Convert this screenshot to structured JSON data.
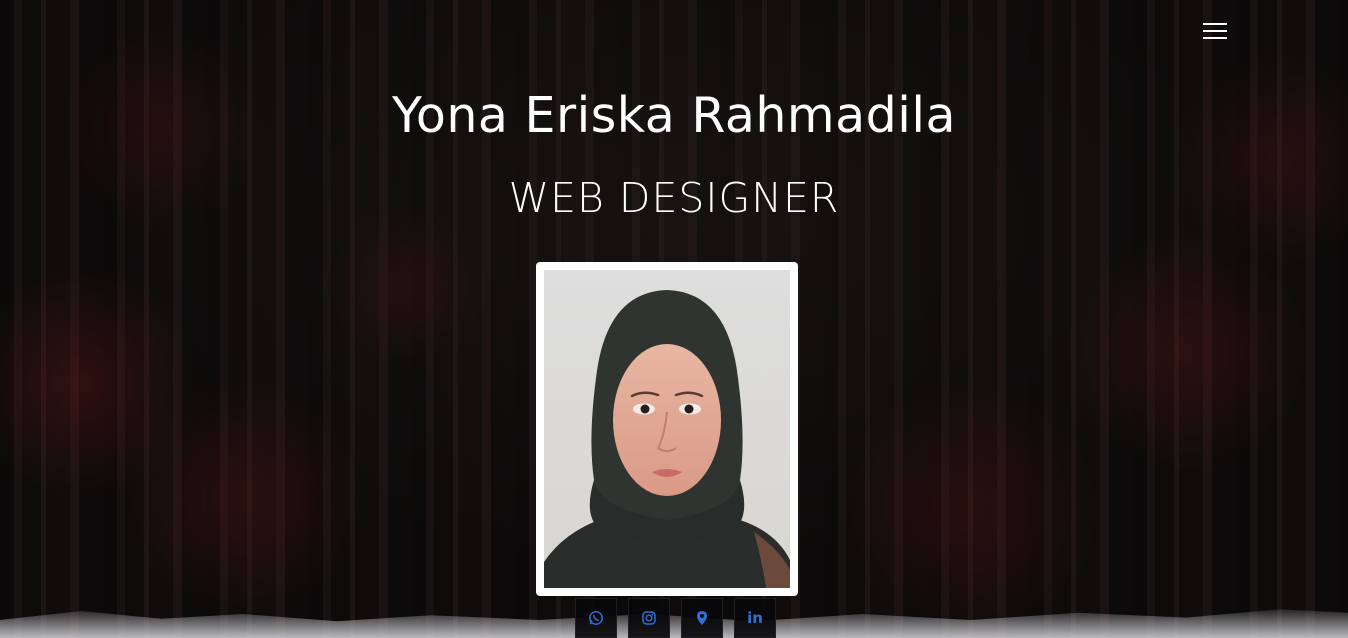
{
  "header": {
    "name": "Yona Eriska Rahmadila",
    "role": "WEB DESIGNER"
  },
  "menu": {
    "icon": "hamburger-menu-icon"
  },
  "profile": {
    "photo": "profile-photo"
  },
  "social": {
    "items": [
      {
        "icon": "whatsapp-icon"
      },
      {
        "icon": "instagram-icon"
      },
      {
        "icon": "location-pin-icon"
      },
      {
        "icon": "linkedin-icon",
        "glyph": "in"
      }
    ],
    "icon_color": "#2f6fd6"
  },
  "colors": {
    "text": "#ffffff",
    "background": "#0e0b0b",
    "accent": "#2f6fd6"
  }
}
